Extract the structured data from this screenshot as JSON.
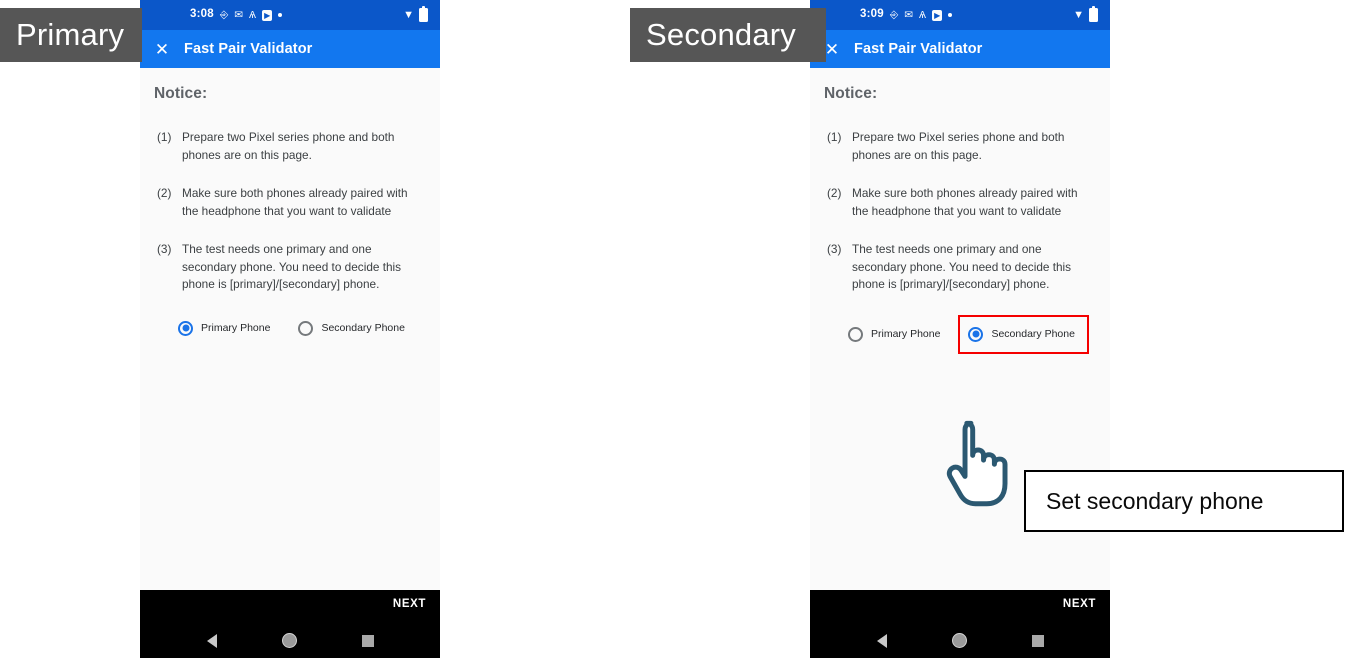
{
  "annotations": {
    "primary_tag": "Primary",
    "secondary_tag": "Secondary",
    "callout_text": "Set secondary phone",
    "highlight_color": "#f50000",
    "tag_bg_color": "#565656",
    "cursor_icon": "pointing-hand-cursor"
  },
  "phones": [
    {
      "id": "primary",
      "status_bar": {
        "time": "3:08",
        "icons": [
          "sim-icon",
          "gmail-icon",
          "y-app-icon",
          "youtube-icon",
          "dot-icon"
        ],
        "wifi": "▼",
        "battery": "battery-icon"
      },
      "app_bar": {
        "close_label": "✕",
        "title": "Fast Pair Validator"
      },
      "content": {
        "notice_heading": "Notice:",
        "notice_items": [
          {
            "num": "(1)",
            "text": "Prepare two Pixel series phone and both phones are on this page."
          },
          {
            "num": "(2)",
            "text": "Make sure both phones already paired with the headphone that you want to validate"
          },
          {
            "num": "(3)",
            "text": "The test needs one primary and one secondary phone. You need to decide this phone is [primary]/[secondary] phone."
          }
        ],
        "radio_options": [
          {
            "label": "Primary Phone",
            "checked": true,
            "highlighted": false
          },
          {
            "label": "Secondary Phone",
            "checked": false,
            "highlighted": false
          }
        ]
      },
      "bottom": {
        "next_label": "NEXT",
        "nav": [
          "back-icon",
          "home-icon",
          "recents-icon"
        ]
      }
    },
    {
      "id": "secondary",
      "status_bar": {
        "time": "3:09",
        "icons": [
          "sim-icon",
          "gmail-icon",
          "y-app-icon",
          "youtube-icon",
          "dot-icon"
        ],
        "wifi": "▼",
        "battery": "battery-icon"
      },
      "app_bar": {
        "close_label": "✕",
        "title": "Fast Pair Validator"
      },
      "content": {
        "notice_heading": "Notice:",
        "notice_items": [
          {
            "num": "(1)",
            "text": "Prepare two Pixel series phone and both phones are on this page."
          },
          {
            "num": "(2)",
            "text": "Make sure both phones already paired with the headphone that you want to validate"
          },
          {
            "num": "(3)",
            "text": "The test needs one primary and one secondary phone. You need to decide this phone is [primary]/[secondary] phone."
          }
        ],
        "radio_options": [
          {
            "label": "Primary Phone",
            "checked": false,
            "highlighted": false
          },
          {
            "label": "Secondary Phone",
            "checked": true,
            "highlighted": true
          }
        ]
      },
      "bottom": {
        "next_label": "NEXT",
        "nav": [
          "back-icon",
          "home-icon",
          "recents-icon"
        ]
      }
    }
  ]
}
